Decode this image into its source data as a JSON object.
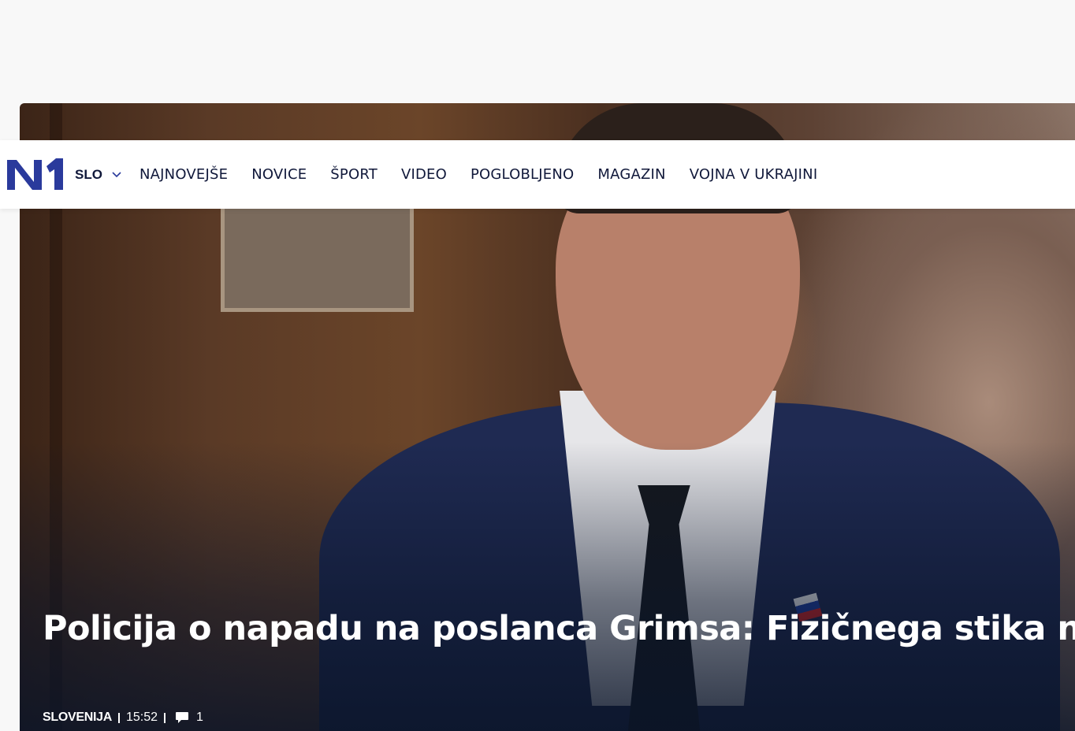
{
  "navbar": {
    "logo_text": "N1",
    "region_label": "SLO",
    "items": [
      {
        "label": "NAJNOVEJŠE"
      },
      {
        "label": "NOVICE"
      },
      {
        "label": "ŠPORT"
      },
      {
        "label": "VIDEO"
      },
      {
        "label": "POGLOBLJENO"
      },
      {
        "label": "MAGAZIN"
      },
      {
        "label": "VOJNA V UKRAJINI"
      }
    ]
  },
  "article": {
    "headline": "Policija o napadu na poslanca Grimsa: Fizičnega stika ni bilo",
    "category": "SLOVENIJA",
    "time": "15:52",
    "comment_count": "1"
  },
  "colors": {
    "brand_blue": "#2a3a9c",
    "nav_text": "#10183a",
    "page_bg": "#f8f8f8"
  },
  "icons": {
    "region_toggle": "chevron-down-icon",
    "comments": "comment-bubble-icon"
  }
}
